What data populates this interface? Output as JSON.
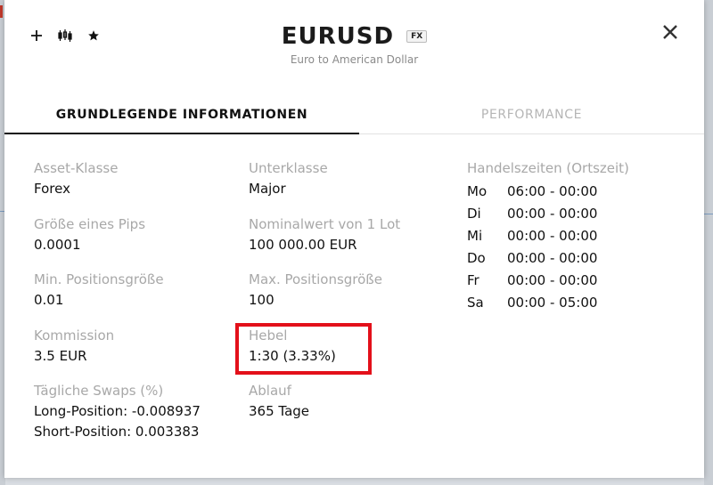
{
  "header": {
    "symbol": "EURUSD",
    "badge": "FX",
    "subtitle": "Euro to American Dollar",
    "icons": [
      "plus-icon",
      "candlestick-chart-icon",
      "star-icon",
      "close-icon"
    ]
  },
  "tabs": [
    {
      "label": "GRUNDLEGENDE INFORMATIONEN",
      "active": true
    },
    {
      "label": "PERFORMANCE",
      "active": false
    }
  ],
  "info": {
    "asset_class": {
      "label": "Asset-Klasse",
      "value": "Forex"
    },
    "subclass": {
      "label": "Unterklasse",
      "value": "Major"
    },
    "pip_size": {
      "label": "Größe eines Pips",
      "value": "0.0001"
    },
    "nominal": {
      "label": "Nominalwert von 1 Lot",
      "value": "100 000.00 EUR"
    },
    "min_pos": {
      "label": "Min. Positionsgröße",
      "value": "0.01"
    },
    "max_pos": {
      "label": "Max. Positionsgröße",
      "value": "100"
    },
    "commission": {
      "label": "Kommission",
      "value": "3.5 EUR"
    },
    "leverage": {
      "label": "Hebel",
      "value": "1:30 (3.33%)"
    },
    "swaps": {
      "label": "Tägliche Swaps (%)",
      "long": "Long-Position: -0.008937",
      "short": "Short-Position: 0.003383"
    },
    "expiry": {
      "label": "Ablauf",
      "value": "365 Tage"
    }
  },
  "trading_hours": {
    "label": "Handelszeiten (Ortszeit)",
    "rows": [
      {
        "day": "Mo",
        "time": "06:00 - 00:00"
      },
      {
        "day": "Di",
        "time": "00:00 - 00:00"
      },
      {
        "day": "Mi",
        "time": "00:00 - 00:00"
      },
      {
        "day": "Do",
        "time": "00:00 - 00:00"
      },
      {
        "day": "Fr",
        "time": "00:00 - 00:00"
      },
      {
        "day": "Sa",
        "time": "00:00 - 05:00"
      }
    ]
  },
  "colors": {
    "highlight": "#e3101a",
    "label": "#a8a8a8",
    "text": "#111111"
  }
}
